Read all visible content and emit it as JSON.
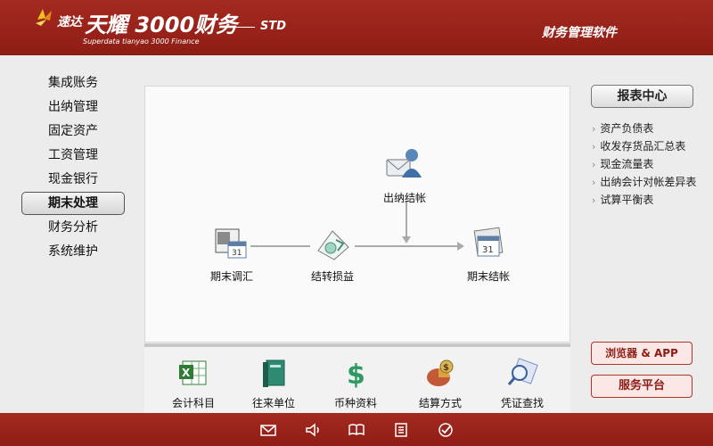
{
  "header": {
    "brand_small": "速达",
    "brand_big": "天耀 3000财务",
    "brand_sub": "Superdata tianyao 3000 Finance",
    "edition": "STD",
    "app_label": "财务管理软件"
  },
  "sidebar": {
    "items": [
      {
        "label": "集成账务"
      },
      {
        "label": "出纳管理"
      },
      {
        "label": "固定资产"
      },
      {
        "label": "工资管理"
      },
      {
        "label": "现金银行"
      },
      {
        "label": "期末处理",
        "active": true
      },
      {
        "label": "财务分析"
      },
      {
        "label": "系统维护"
      }
    ]
  },
  "flow": {
    "cashier_close": "出纳结帐",
    "period_adjust": "期末调汇",
    "carry_profit": "结转损益",
    "period_close": "期末结帐"
  },
  "toolbar": {
    "items": [
      {
        "label": "会计科目",
        "icon": "excel-sheet-icon"
      },
      {
        "label": "往来单位",
        "icon": "green-book-icon"
      },
      {
        "label": "币种资料",
        "icon": "dollar-sign-icon"
      },
      {
        "label": "结算方式",
        "icon": "money-bag-icon"
      },
      {
        "label": "凭证查找",
        "icon": "magnifier-icon"
      }
    ]
  },
  "reports": {
    "title": "报表中心",
    "items": [
      "资产负债表",
      "收发存货品汇总表",
      "现金流量表",
      "出纳会计对帐差异表",
      "试算平衡表"
    ]
  },
  "buttons": {
    "browser_app": "浏览器 & APP",
    "service_platform": "服务平台"
  },
  "colors": {
    "brand_red": "#9a241b",
    "panel_bg": "#fafafa",
    "button_pink": "#fbe7e5"
  }
}
